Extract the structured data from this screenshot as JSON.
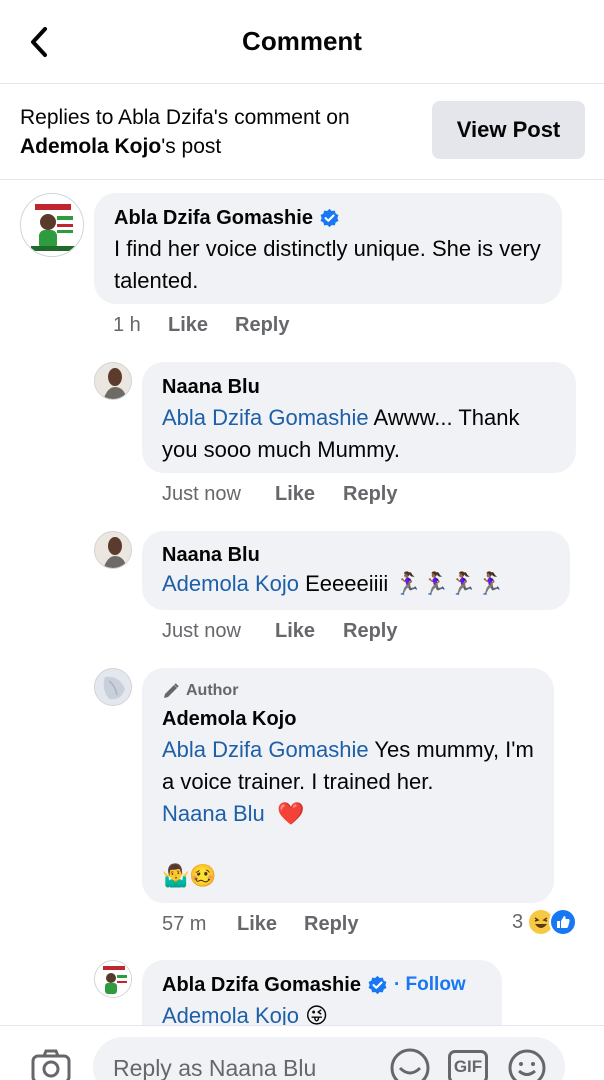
{
  "header": {
    "title": "Comment"
  },
  "context": {
    "prefix": "Replies to Abla Dzifa's comment on",
    "post_owner": "Ademola Kojo",
    "post_suffix": "'s post",
    "view_post_label": "View Post"
  },
  "comments": [
    {
      "name": "Abla Dzifa Gomashie",
      "text": "I find her voice distinctly unique. She is very talented.",
      "time": "1 h",
      "like": "Like",
      "reply": "Reply"
    },
    {
      "name": "Naana Blu",
      "mention": "Abla Dzifa Gomashie",
      "text": " Awww... Thank you sooo much Mummy.",
      "time": "Just now",
      "like": "Like",
      "reply": "Reply"
    },
    {
      "name": "Naana Blu",
      "mention": "Ademola Kojo",
      "text": " Eeeeeiiii 🏃🏾‍♀️🏃🏾‍♀️🏃🏾‍♀️🏃🏾‍♀️",
      "time": "Just now",
      "like": "Like",
      "reply": "Reply"
    },
    {
      "author_tag": "Author",
      "name": "Ademola Kojo",
      "mention": "Abla Dzifa Gomashie",
      "text": " Yes mummy, I'm a voice trainer. I trained her.",
      "mention2": "Naana Blu",
      "emoji_end": "❤️",
      "emoji_line": "🤷‍♂️🥴",
      "time": "57 m",
      "like": "Like",
      "reply": "Reply",
      "reaction_count": "3"
    },
    {
      "name": "Abla Dzifa Gomashie",
      "follow": "· Follow",
      "mention": "Ademola Kojo",
      "text": " 😜"
    }
  ],
  "composer": {
    "placeholder": "Reply as Naana Blu",
    "gif_label": "GIF"
  },
  "colors": {
    "mention": "#1d5fa8",
    "verified": "#1877f2",
    "bubble": "#f0f2f5"
  }
}
